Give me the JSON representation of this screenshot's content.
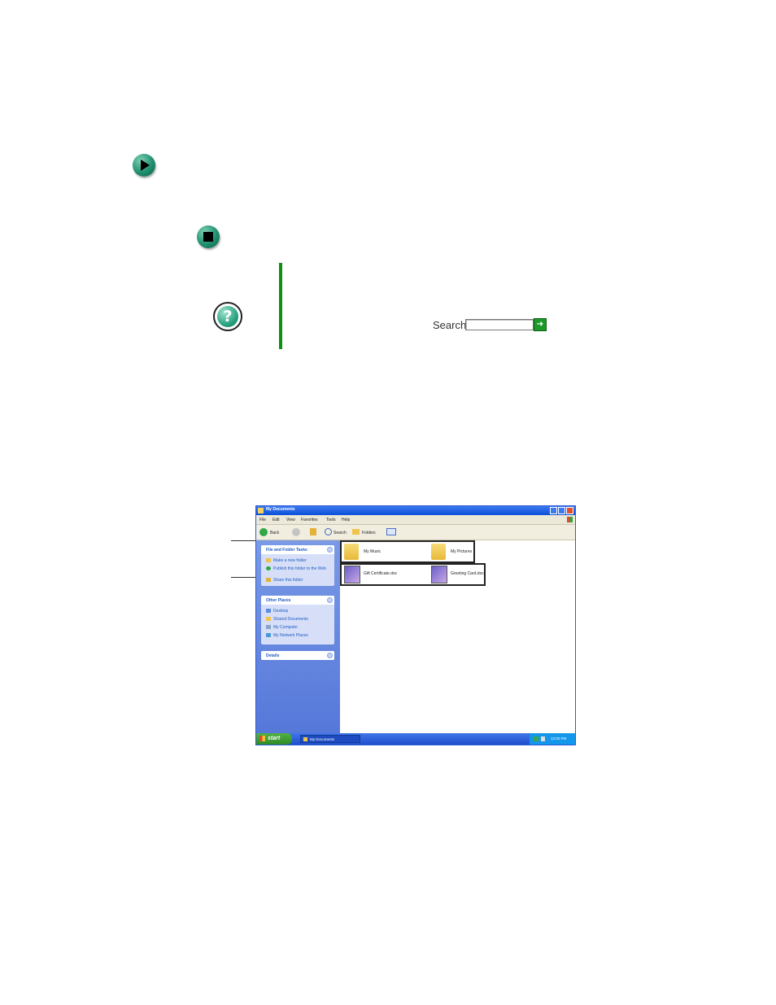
{
  "help_search": {
    "label": "Search",
    "input_value": "",
    "go_icon": "arrow-right-icon"
  },
  "icons": {
    "step": "play-arrow-icon",
    "end": "stop-icon",
    "help": "help-question-icon"
  },
  "colors": {
    "rule": "#109010",
    "icon_green": "#1f8f6e",
    "xp_blue": "#0a4fd8"
  },
  "screenshot": {
    "title": "My Documents",
    "menu": [
      "File",
      "Edit",
      "View",
      "Favorites",
      "Tools",
      "Help"
    ],
    "toolbar": {
      "back": "Back",
      "search": "Search",
      "folders": "Folders"
    },
    "side_panels": [
      {
        "title": "File and Folder Tasks",
        "items": [
          "Make a new folder",
          "Publish this folder to the Web",
          "Share this folder"
        ]
      },
      {
        "title": "Other Places",
        "items": [
          "Desktop",
          "Shared Documents",
          "My Computer",
          "My Network Places"
        ]
      },
      {
        "title": "Details",
        "items": []
      }
    ],
    "folders": [
      "My Music",
      "My Pictures"
    ],
    "files": [
      "Gift Certificate.doc",
      "Greeting Card.doc"
    ],
    "taskbar": {
      "start": "start",
      "task": "My Documents",
      "clock": "12:00 PM"
    }
  }
}
